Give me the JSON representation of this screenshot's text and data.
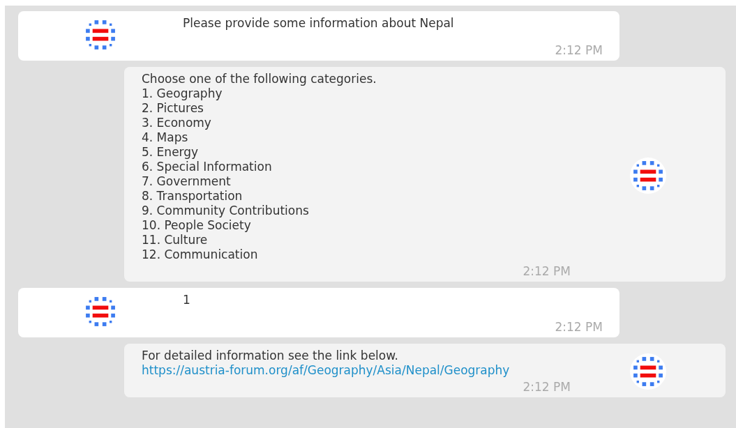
{
  "messages": [
    {
      "kind": "user",
      "lines": [
        "Please provide some information about Nepal"
      ],
      "time": "2:12 PM"
    },
    {
      "kind": "bot",
      "lines": [
        "Choose one of the following categories.",
        "1. Geography",
        "2. Pictures",
        "3. Economy",
        "4. Maps",
        "5. Energy",
        "6. Special Information",
        "7. Government",
        "8. Transportation",
        "9. Community Contributions",
        "10. People Society",
        "11. Culture",
        "12. Communication"
      ],
      "time": "2:12 PM"
    },
    {
      "kind": "user",
      "lines": [
        "1"
      ],
      "time": "2:12 PM"
    },
    {
      "kind": "bot",
      "lines": [
        "For detailed information see the link below."
      ],
      "link": "https://austria-forum.org/af/Geography/Asia/Nepal/Geography",
      "time": "2:12 PM"
    }
  ]
}
